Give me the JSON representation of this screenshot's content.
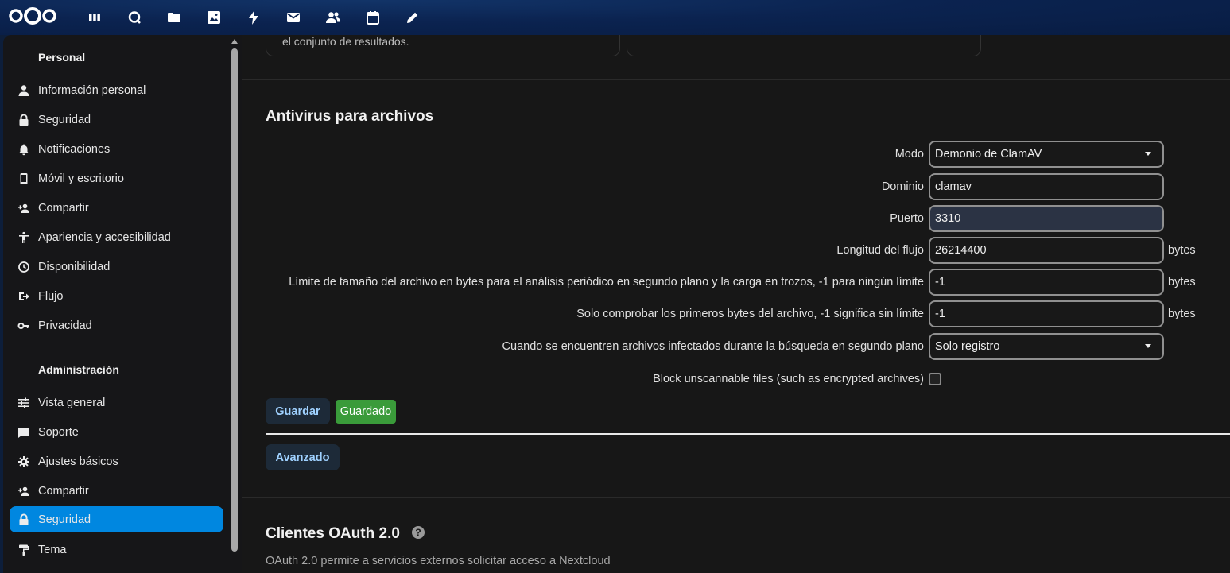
{
  "topbar": {
    "apps": [
      {
        "name": "dashboard-icon"
      },
      {
        "name": "search-icon"
      },
      {
        "name": "files-icon"
      },
      {
        "name": "photos-icon"
      },
      {
        "name": "activity-icon"
      },
      {
        "name": "mail-icon"
      },
      {
        "name": "contacts-icon"
      },
      {
        "name": "calendar-icon"
      },
      {
        "name": "notes-icon"
      }
    ]
  },
  "sidebar": {
    "personal_title": "Personal",
    "personal_items": [
      {
        "label": "Información personal",
        "icon": "user-icon"
      },
      {
        "label": "Seguridad",
        "icon": "lock-icon"
      },
      {
        "label": "Notificaciones",
        "icon": "bell-icon"
      },
      {
        "label": "Móvil y escritorio",
        "icon": "phone-icon"
      },
      {
        "label": "Compartir",
        "icon": "share-user-icon"
      },
      {
        "label": "Apariencia y accesibilidad",
        "icon": "accessibility-icon"
      },
      {
        "label": "Disponibilidad",
        "icon": "clock-icon"
      },
      {
        "label": "Flujo",
        "icon": "flow-icon"
      },
      {
        "label": "Privacidad",
        "icon": "key-icon"
      }
    ],
    "admin_title": "Administración",
    "admin_items": [
      {
        "label": "Vista general",
        "icon": "sliders-icon"
      },
      {
        "label": "Soporte",
        "icon": "chat-icon"
      },
      {
        "label": "Ajustes básicos",
        "icon": "gear-icon"
      },
      {
        "label": "Compartir",
        "icon": "share-user-icon"
      },
      {
        "label": "Seguridad",
        "icon": "lock-icon",
        "active": true
      },
      {
        "label": "Tema",
        "icon": "paint-roller-icon"
      }
    ]
  },
  "main": {
    "top_card_text": "el conjunto de resultados.",
    "antivirus": {
      "title": "Antivirus para archivos",
      "mode_label": "Modo",
      "mode_value": "Demonio de ClamAV",
      "host_label": "Dominio",
      "host_value": "clamav",
      "port_label": "Puerto",
      "port_value": "3310",
      "stream_label": "Longitud del flujo",
      "stream_value": "26214400",
      "filesize_label": "Límite de tamaño del archivo en bytes para el análisis periódico en segundo plano y la carga en trozos, -1 para ningún límite",
      "filesize_value": "-1",
      "scan_first_label": "Solo comprobar los primeros bytes del archivo, -1 significa sin límite",
      "scan_first_value": "-1",
      "infected_label": "Cuando se encuentren archivos infectados durante la búsqueda en segundo plano",
      "infected_value": "Solo registro",
      "block_label": "Block unscannable files (such as encrypted archives)",
      "unit": "bytes",
      "save_label": "Guardar",
      "saved_label": "Guardado",
      "advanced_label": "Avanzado"
    },
    "oauth": {
      "title": "Clientes OAuth 2.0",
      "help": "?",
      "description": "OAuth 2.0 permite a servicios externos solicitar acceso a Nextcloud"
    }
  }
}
